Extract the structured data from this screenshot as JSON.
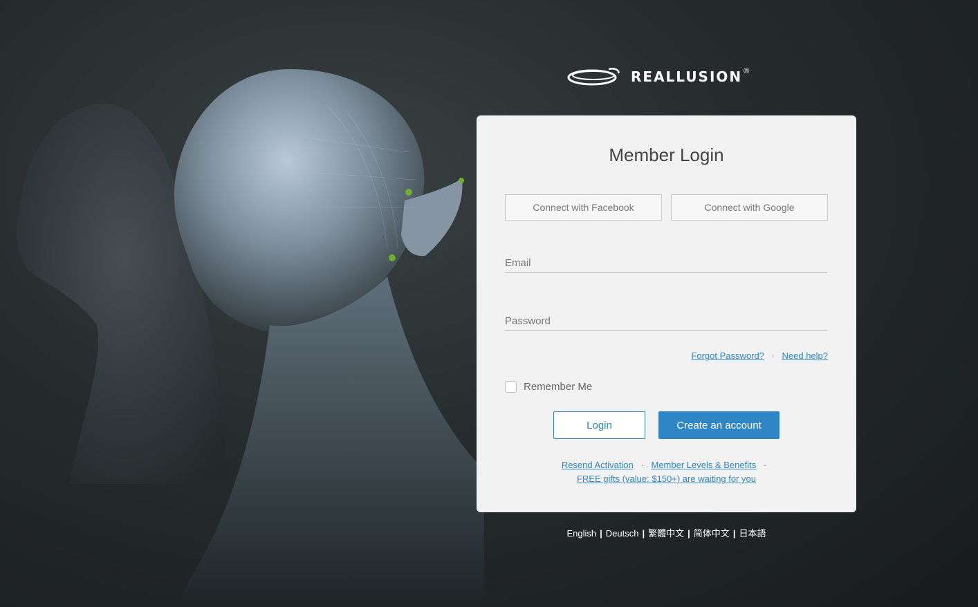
{
  "brand": {
    "name": "REALLUSION",
    "registered_mark": "®"
  },
  "login_card": {
    "title": "Member Login",
    "connect_facebook": "Connect with Facebook",
    "connect_google": "Connect with Google",
    "email_placeholder": "Email",
    "password_placeholder": "Password",
    "forgot_password": "Forgot Password?",
    "need_help": "Need help?",
    "separator": "·",
    "remember_me": "Remember Me",
    "login_button": "Login",
    "create_account_button": "Create an account",
    "resend_activation": "Resend Activation",
    "member_levels": "Member Levels & Benefits",
    "free_gifts": "FREE gifts (value: $150+) are waiting for you"
  },
  "languages": {
    "items": [
      "English",
      "Deutsch",
      "繁體中文",
      "简体中文",
      "日本語"
    ],
    "divider": "|"
  },
  "colors": {
    "accent": "#2f86c6",
    "card_background": "#f2f2f2",
    "page_background": "#262c2d"
  }
}
